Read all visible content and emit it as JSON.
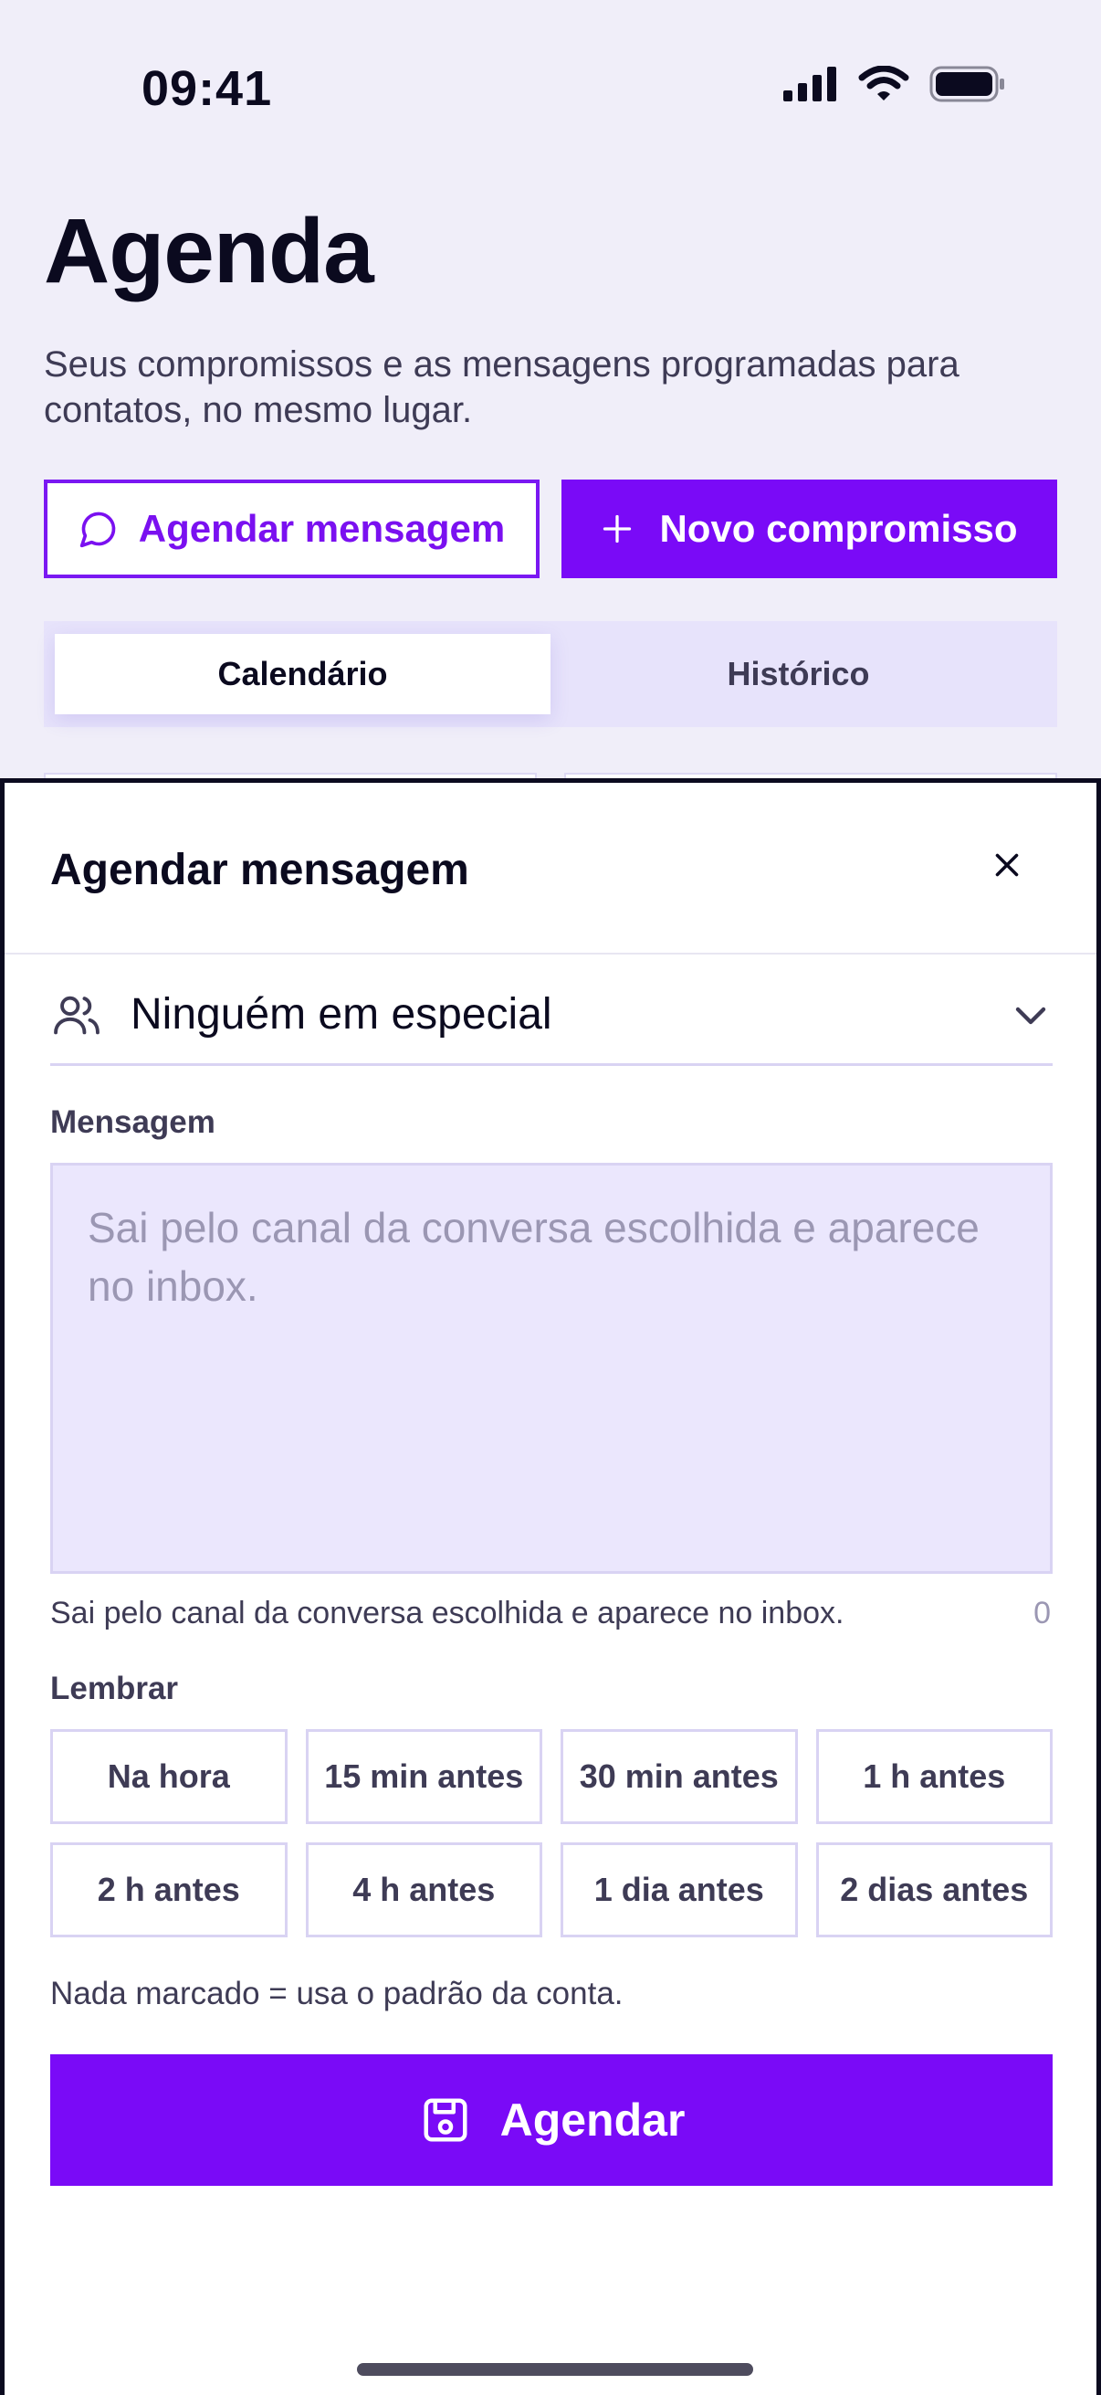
{
  "status_bar": {
    "time": "09:41"
  },
  "header": {
    "title": "Agenda",
    "subtitle": "Seus compromissos e as mensagens programadas para contatos, no mesmo lugar."
  },
  "actions": {
    "schedule_message_label": "Agendar mensagem",
    "new_appointment_label": "Novo compromisso"
  },
  "tabs": [
    {
      "label": "Calendário",
      "active": true
    },
    {
      "label": "Histórico",
      "active": false
    }
  ],
  "sheet": {
    "title": "Agendar mensagem",
    "contact_select": {
      "value": "Ninguém em especial"
    },
    "message": {
      "label": "Mensagem",
      "placeholder": "Sai pelo canal da conversa escolhida e aparece no inbox.",
      "value": "",
      "helper": "Sai pelo canal da conversa escolhida e aparece no inbox.",
      "char_count": "0"
    },
    "remind": {
      "label": "Lembrar",
      "options": [
        "Na hora",
        "15 min antes",
        "30 min antes",
        "1 h antes",
        "2 h antes",
        "4 h antes",
        "1 dia antes",
        "2 dias antes"
      ]
    },
    "default_note": "Nada marcado = usa o padrão da conta.",
    "submit_label": "Agendar"
  },
  "colors": {
    "accent": "#7a0af7",
    "background": "#f0eef9",
    "input_bg": "#ebe7fd",
    "text": "#0b0a1f"
  },
  "icons": {
    "schedule_message": "chat-bubble-icon",
    "new_appointment": "plus-icon",
    "close": "close-icon",
    "contact": "users-icon",
    "dropdown": "chevron-down-icon",
    "submit": "save-icon"
  }
}
